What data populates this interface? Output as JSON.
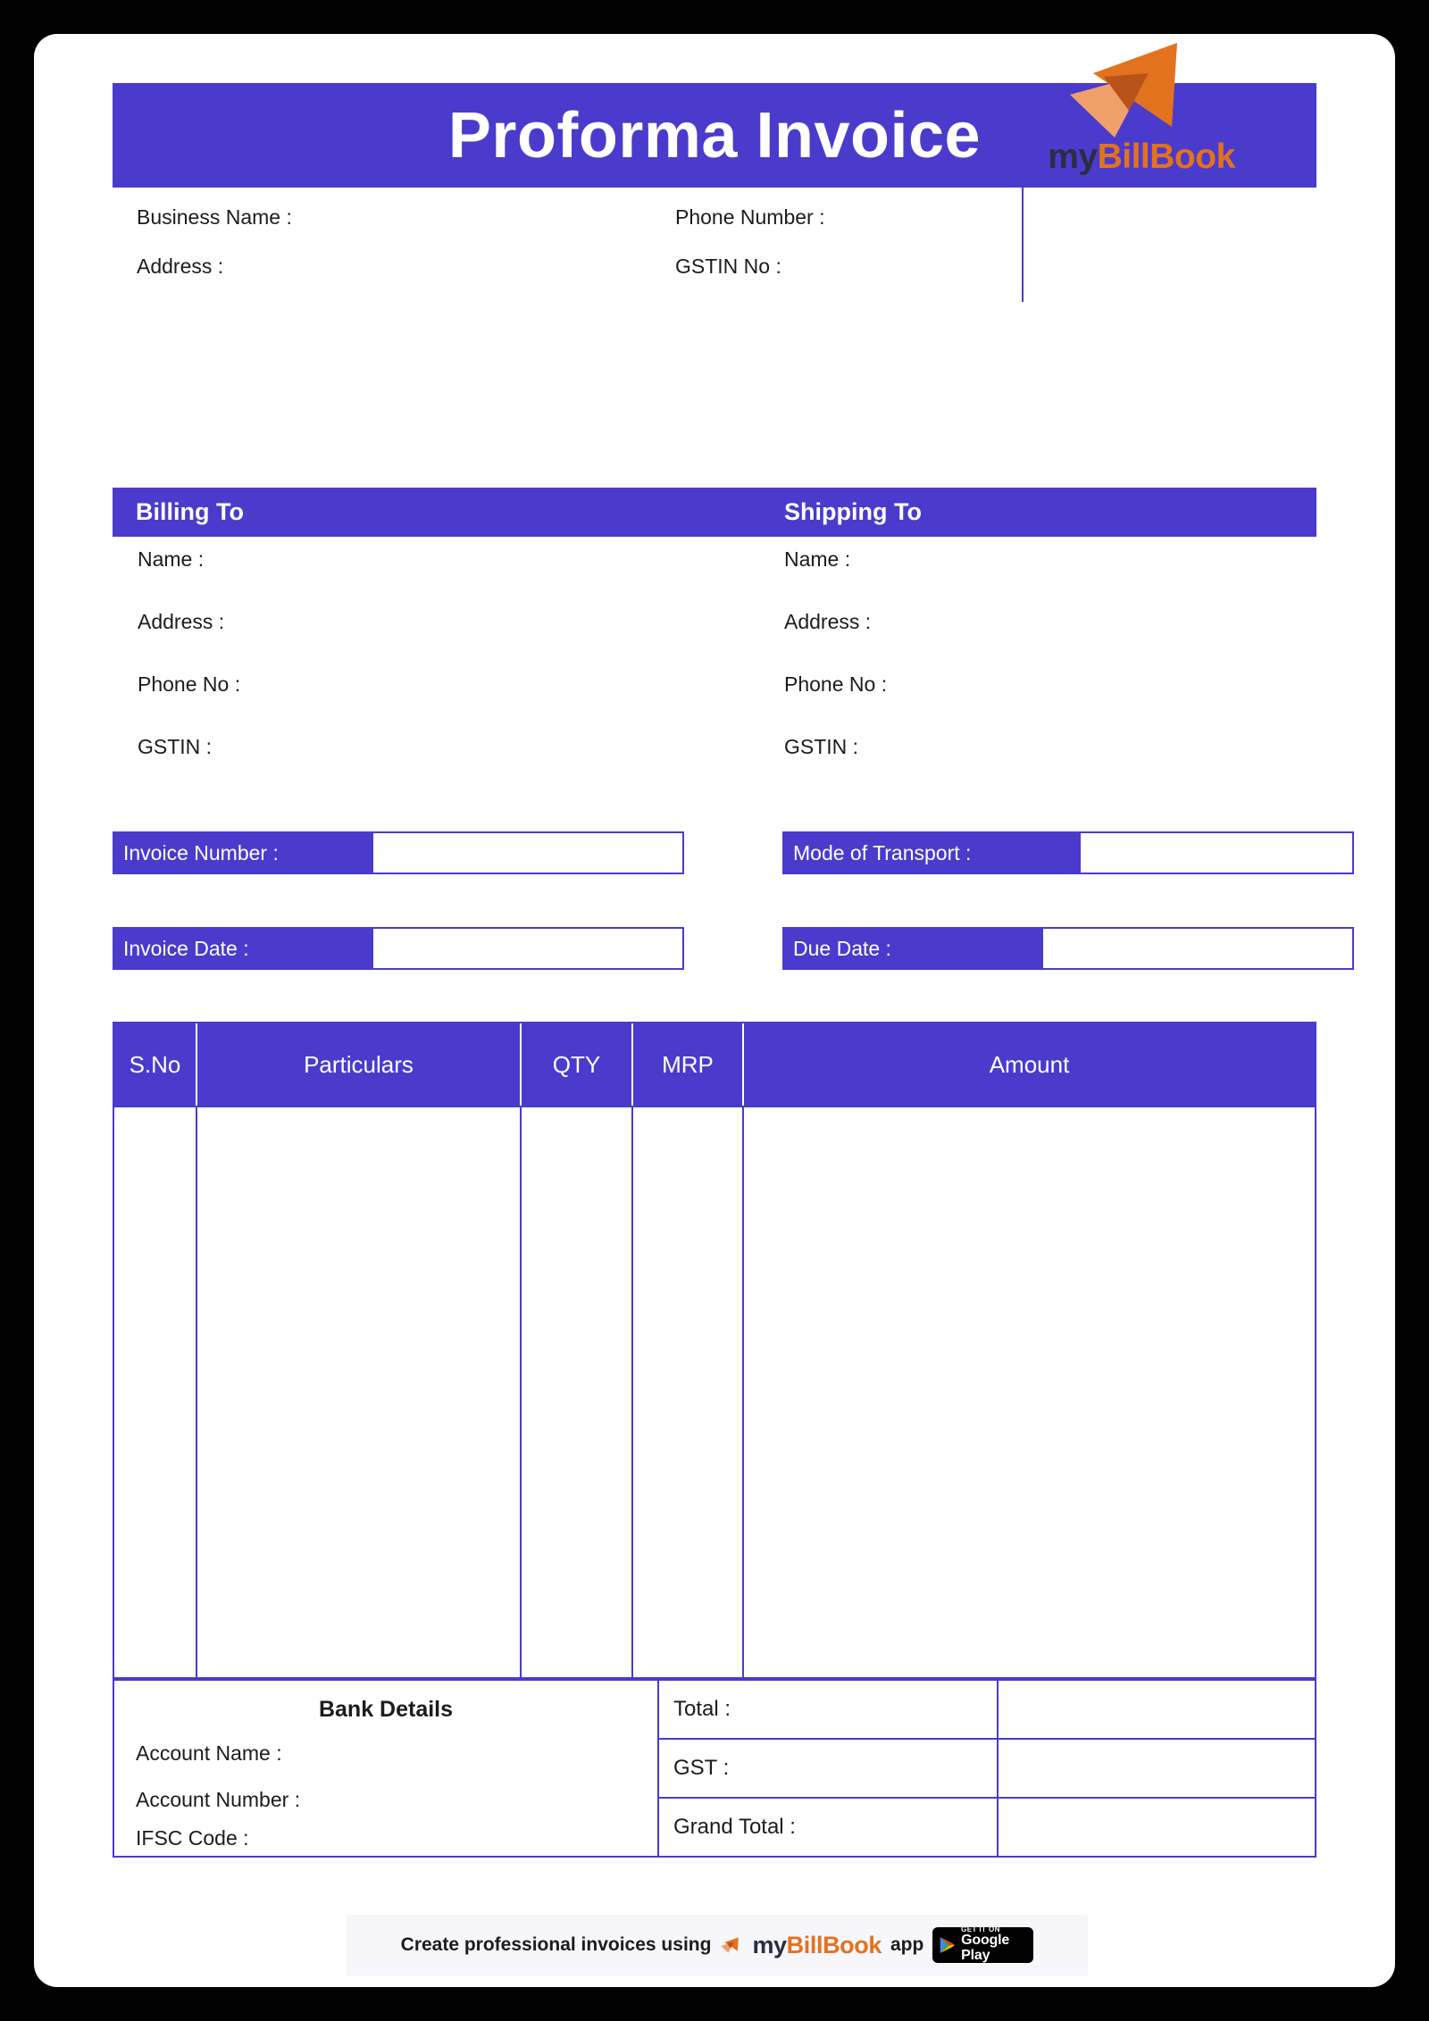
{
  "theme": {
    "accent": "#4a3bcc",
    "logo_orange": "#e3721f",
    "logo_orange_light": "#f0a06a",
    "logo_orange_dark": "#b9531b",
    "logo_dark": "#2b2d42",
    "footer_bg": "#f7f6fb",
    "page_bg": "#ffffff",
    "outer_bg": "#000000"
  },
  "title": "Proforma Invoice",
  "business": {
    "name_label": "Business Name :",
    "address_label": "Address :",
    "phone_label": "Phone Number :",
    "gstin_label": "GSTIN No :"
  },
  "logo": {
    "icon": "paper-plane-icon",
    "wordmark_part1": "my",
    "wordmark_part2": "BillBook"
  },
  "billing": {
    "header": "Billing To",
    "lines": [
      "Name :",
      "Address :",
      "Phone No :",
      "GSTIN :"
    ]
  },
  "shipping": {
    "header": "Shipping To",
    "lines": [
      "Name :",
      "Address :",
      "Phone No :",
      "GSTIN :"
    ]
  },
  "meta_fields": {
    "invoice_number": {
      "label": "Invoice Number :",
      "value": ""
    },
    "mode_of_transport": {
      "label": "Mode of Transport :",
      "value": ""
    },
    "invoice_date": {
      "label": "Invoice Date :",
      "value": ""
    },
    "due_date": {
      "label": "Due Date :",
      "value": ""
    }
  },
  "items_table": {
    "columns": [
      "S.No",
      "Particulars",
      "QTY",
      "MRP",
      "Amount"
    ],
    "rows": []
  },
  "bank": {
    "title": "Bank Details",
    "account_name_label": "Account Name :",
    "account_number_label": "Account Number :",
    "ifsc_label": "IFSC Code :"
  },
  "totals": [
    {
      "label": "Total :",
      "value": ""
    },
    {
      "label": "GST :",
      "value": ""
    },
    {
      "label": "Grand Total :",
      "value": ""
    }
  ],
  "footer": {
    "text": "Create professional invoices using",
    "wordmark_part1": "my",
    "wordmark_part2": "BillBook",
    "app_word": "app",
    "store_badge_top": "GET IT ON",
    "store_badge_bottom": "Google Play",
    "plane_icon": "paper-plane-icon",
    "store_icon": "google-play-icon"
  }
}
